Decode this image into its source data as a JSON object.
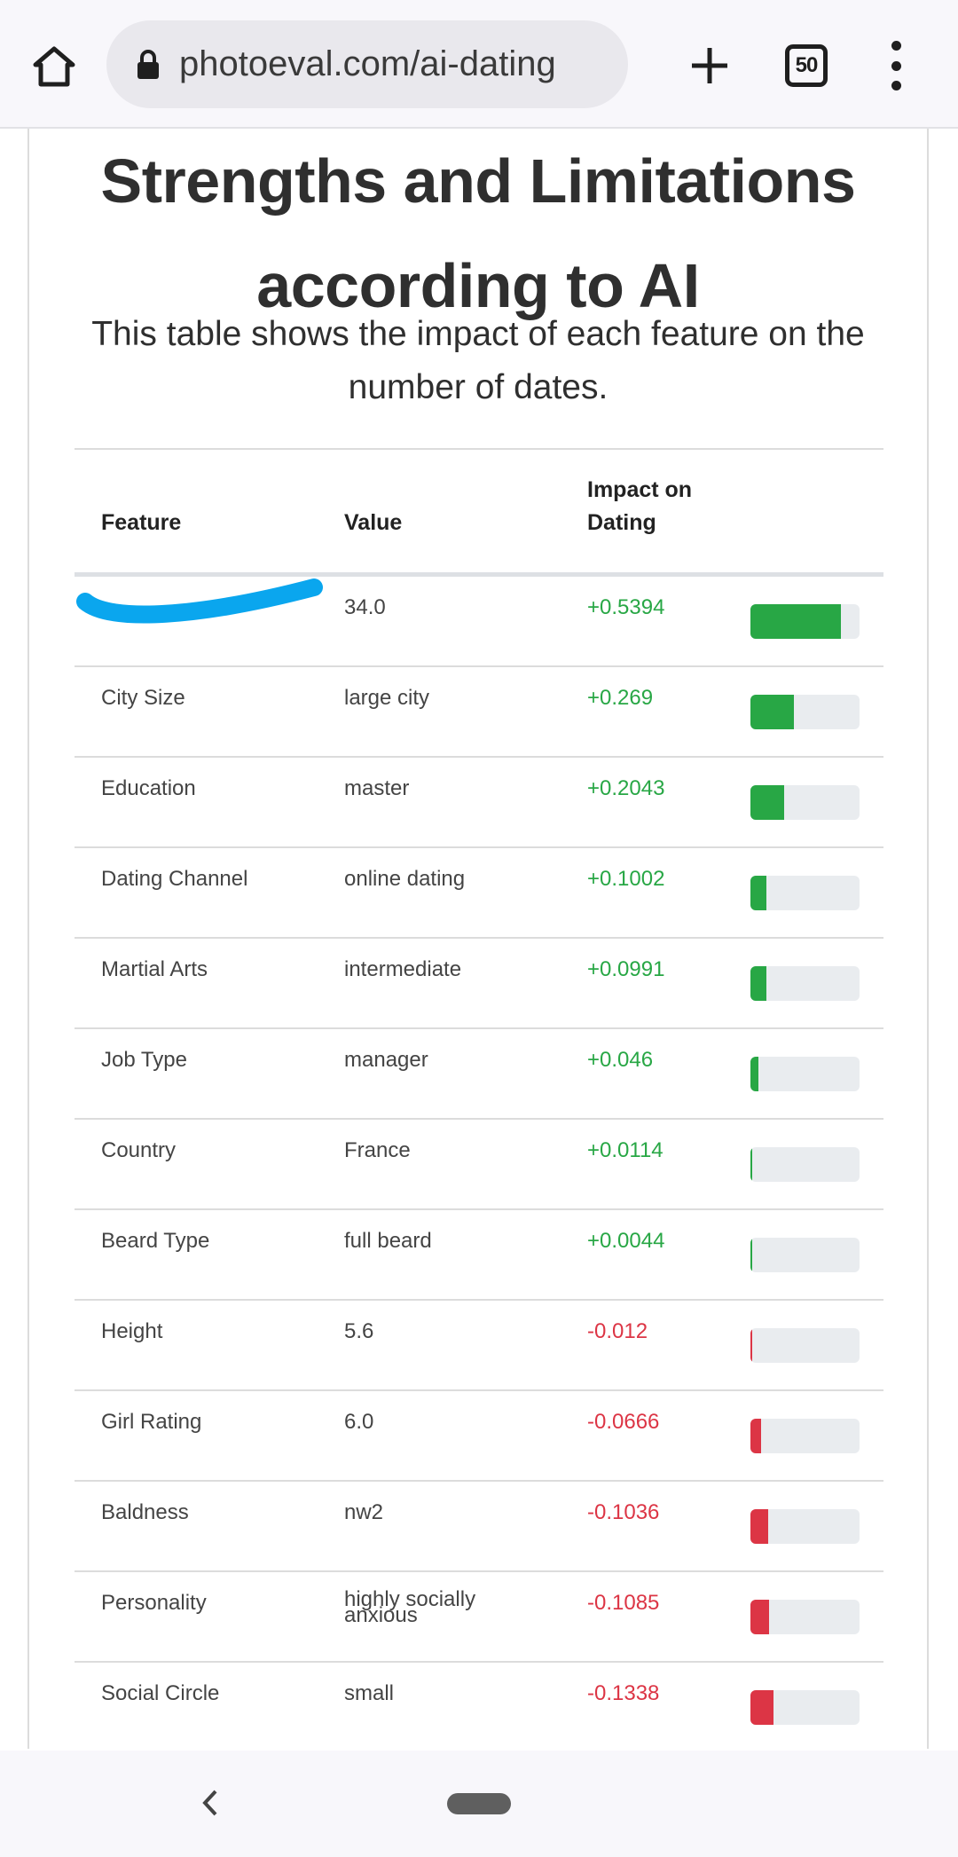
{
  "browser": {
    "url": "photoeval.com/ai-dating",
    "tab_count": "50",
    "icons": {
      "home": "home-icon",
      "lock": "lock-icon",
      "new_tab": "plus-icon",
      "menu": "more-vert-icon"
    }
  },
  "page": {
    "title": "Strengths and Limitations according to AI",
    "subtitle": "This table shows the impact of each feature on the number of dates."
  },
  "table": {
    "headers": {
      "feature": "Feature",
      "value": "Value",
      "impact": "Impact on Dating"
    },
    "rows": [
      {
        "feature": "",
        "value": "34.0",
        "impact": "+0.5394",
        "sign": "positive",
        "bar_fraction": 0.83
      },
      {
        "feature": "City Size",
        "value": "large city",
        "impact": "+0.269",
        "sign": "positive",
        "bar_fraction": 0.4
      },
      {
        "feature": "Education",
        "value": "master",
        "impact": "+0.2043",
        "sign": "positive",
        "bar_fraction": 0.31
      },
      {
        "feature": "Dating Channel",
        "value": "online dating",
        "impact": "+0.1002",
        "sign": "positive",
        "bar_fraction": 0.15
      },
      {
        "feature": "Martial Arts",
        "value": "intermediate",
        "impact": "+0.0991",
        "sign": "positive",
        "bar_fraction": 0.15
      },
      {
        "feature": "Job Type",
        "value": "manager",
        "impact": "+0.046",
        "sign": "positive",
        "bar_fraction": 0.07
      },
      {
        "feature": "Country",
        "value": "France",
        "impact": "+0.0114",
        "sign": "positive",
        "bar_fraction": 0.02
      },
      {
        "feature": "Beard Type",
        "value": "full beard",
        "impact": "+0.0044",
        "sign": "positive",
        "bar_fraction": 0.01
      },
      {
        "feature": "Height",
        "value": "5.6",
        "impact": "-0.012",
        "sign": "negative",
        "bar_fraction": 0.02
      },
      {
        "feature": "Girl Rating",
        "value": "6.0",
        "impact": "-0.0666",
        "sign": "negative",
        "bar_fraction": 0.1
      },
      {
        "feature": "Baldness",
        "value": "nw2",
        "impact": "-0.1036",
        "sign": "negative",
        "bar_fraction": 0.16
      },
      {
        "feature": "Personality",
        "value": "highly socially anxious",
        "impact": "-0.1085",
        "sign": "negative",
        "bar_fraction": 0.17
      },
      {
        "feature": "Social Circle",
        "value": "small",
        "impact": "-0.1338",
        "sign": "negative",
        "bar_fraction": 0.21
      }
    ]
  },
  "colors": {
    "positive": "#28a745",
    "negative": "#dc3545",
    "track": "#e9ecef",
    "redaction": "#0aa6ee"
  },
  "navbar": {
    "icons": {
      "back": "back-chevron-icon",
      "home": "home-pill-icon"
    }
  }
}
